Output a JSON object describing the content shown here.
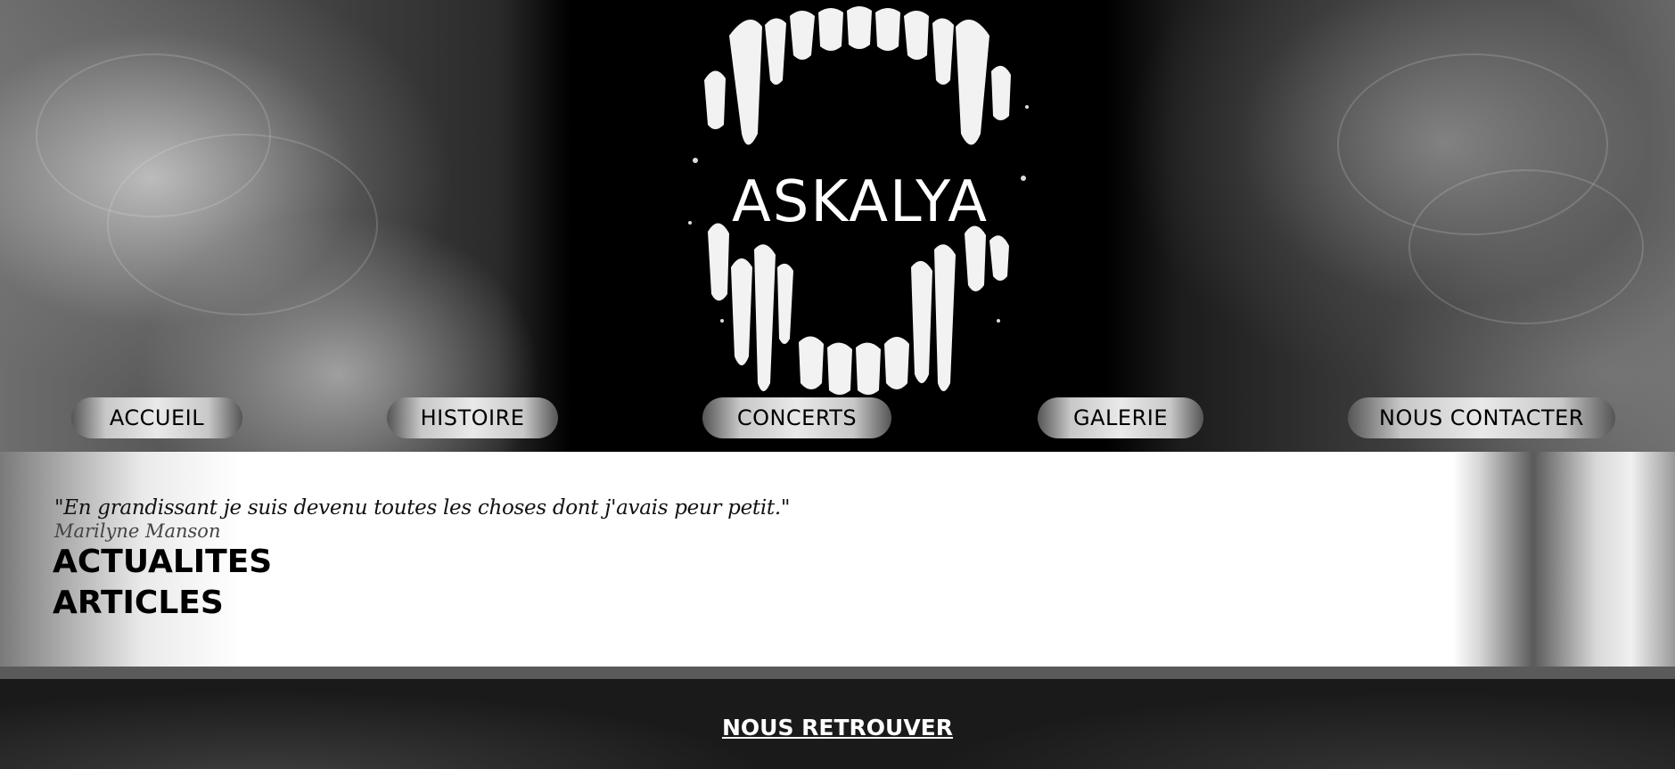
{
  "logo": {
    "band_name": "ASKALYA"
  },
  "nav": {
    "items": [
      {
        "label": "ACCUEIL"
      },
      {
        "label": "HISTOIRE"
      },
      {
        "label": "CONCERTS"
      },
      {
        "label": "GALERIE"
      },
      {
        "label": "NOUS CONTACTER"
      }
    ]
  },
  "main": {
    "quote": "\"En grandissant je suis devenu toutes les choses dont j'avais peur petit.\"",
    "quote_author": "Marilyne Manson",
    "section_actualites": "ACTUALITES",
    "section_articles": "ARTICLES"
  },
  "footer": {
    "link_label": "NOUS RETROUVER"
  },
  "colors": {
    "page_background": "#0d0d0d",
    "content_background": "#ffffff",
    "text_dark": "#000000",
    "text_light": "#ffffff"
  }
}
